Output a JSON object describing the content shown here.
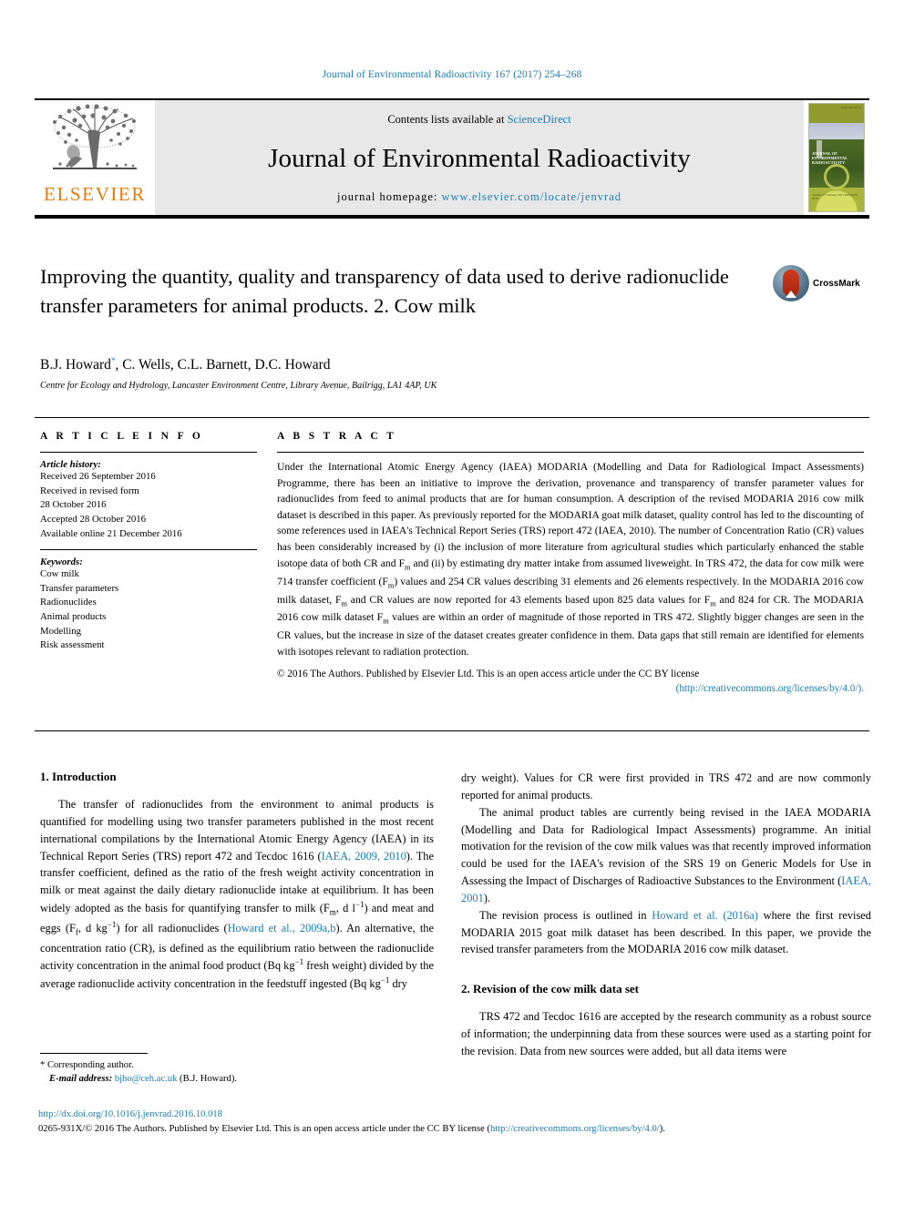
{
  "running_head": "Journal of Environmental Radioactivity 167 (2017) 254–268",
  "masthead": {
    "publisher": "ELSEVIER",
    "contents_prefix": "Contents lists available at ",
    "contents_link": "ScienceDirect",
    "journal_title": "Journal of Environmental Radioactivity",
    "homepage_prefix": "journal homepage: ",
    "homepage_url": "www.elsevier.com/locate/jenvrad",
    "cover_top_label": "ISSN 0265-931X",
    "cover_title_line1": "JOURNAL OF",
    "cover_title_line2": "ENVIRONMENTAL",
    "cover_title_line3": "RADIOACTIVITY",
    "cover_bottom_label": "Volume 167\nFebruary 2017\nISSN 0265-931X"
  },
  "article": {
    "title": "Improving the quantity, quality and transparency of data used to derive radionuclide transfer parameters for animal products. 2. Cow milk",
    "authors": "B.J. Howard",
    "authors_rest": ", C. Wells, C.L. Barnett, D.C. Howard",
    "corresponding_marker": "*",
    "affiliation": "Centre for Ecology and Hydrology, Lancaster Environment Centre, Library Avenue, Bailrigg, LA1 4AP, UK",
    "crossmark_label": "CrossMark"
  },
  "article_info": {
    "heading": "A R T I C L E    I N F O",
    "history_label": "Article history:",
    "history": [
      "Received 26 September 2016",
      "Received in revised form",
      "28 October 2016",
      "Accepted 28 October 2016",
      "Available online 21 December 2016"
    ],
    "keywords_label": "Keywords:",
    "keywords": [
      "Cow milk",
      "Transfer parameters",
      "Radionuclides",
      "Animal products",
      "Modelling",
      "Risk assessment"
    ]
  },
  "abstract": {
    "heading": "A B S T R A C T",
    "part1": "Under the International Atomic Energy Agency (IAEA) MODARIA (Modelling and Data for Radiological Impact Assessments) Programme, there has been an initiative to improve the derivation, provenance and transparency of transfer parameter values for radionuclides from feed to animal products that are for human consumption. A description of the revised MODARIA 2016 cow milk dataset is described in this paper. As previously reported for the MODARIA goat milk dataset, quality control has led to the discounting of some references used in IAEA's Technical Report Series (TRS) report 472 (IAEA, 2010). The number of Concentration Ratio (CR) values has been considerably increased by (i) the inclusion of more literature from agricultural studies which particularly enhanced the stable isotope data of both CR and F",
    "sub1": "m",
    "part2": " and (ii) by estimating dry matter intake from assumed liveweight. In TRS 472, the data for cow milk were 714 transfer coefficient (F",
    "sub2": "m",
    "part3": ") values and 254 CR values describing 31 elements and 26 elements respectively. In the MODARIA 2016 cow milk dataset, F",
    "sub3": "m",
    "part4": " and CR values are now reported for 43 elements based upon 825 data values for F",
    "sub4": "m",
    "part5": " and 824 for CR. The MODARIA 2016 cow milk dataset F",
    "sub5": "m",
    "part6": " values are within an order of magnitude of those reported in TRS 472. Slightly bigger changes are seen in the CR values, but the increase in size of the dataset creates greater confidence in them. Data gaps that still remain are identified for elements with isotopes relevant to radiation protection.",
    "copyright": "© 2016 The Authors. Published by Elsevier Ltd. This is an open access article under the CC BY license",
    "license_url": "(http://creativecommons.org/licenses/by/4.0/)."
  },
  "sections": {
    "intro_heading": "1. Introduction",
    "intro_p1_a": "The transfer of radionuclides from the environment to animal products is quantified for modelling using two transfer parameters published in the most recent international compilations by the International Atomic Energy Agency (IAEA) in its Technical Report Series (TRS) report 472 and Tecdoc 1616 (",
    "intro_p1_ref1": "IAEA, 2009, 2010",
    "intro_p1_b": "). The transfer coefficient, defined as the ratio of the fresh weight activity concentration in milk or meat against the daily dietary radionuclide intake at equilibrium. It has been widely adopted as the basis for quantifying transfer to milk (F",
    "intro_sub_m": "m",
    "intro_p1_c": ", d l",
    "intro_sup_n1": "−1",
    "intro_p1_d": ") and meat and eggs (F",
    "intro_sub_f": "f",
    "intro_p1_e": ", d kg",
    "intro_sup_n2": "−1",
    "intro_p1_f": ") for all radionuclides (",
    "intro_p1_ref2": "Howard et al., 2009a,b",
    "intro_p1_g": "). An alternative, the concentration ratio (CR), is defined as the equilibrium ratio between the radionuclide activity concentration in the animal food product (Bq kg",
    "intro_sup_n3": "−1",
    "intro_p1_h": " fresh weight) divided by the average radionuclide activity concentration in the feedstuff ingested (Bq kg",
    "intro_sup_n4": "−1",
    "intro_p1_i": " dry weight). Values for CR were first provided in TRS 472 and are now commonly reported for animal products.",
    "intro_p2_a": "The animal product tables are currently being revised in the IAEA MODARIA (Modelling and Data for Radiological Impact Assessments) programme. An initial motivation for the revision of the cow milk values was that recently improved information could be used for the IAEA's revision of the SRS 19 on Generic Models for Use in Assessing the Impact of Discharges of Radioactive Substances to the Environment (",
    "intro_p2_ref": "IAEA, 2001",
    "intro_p2_b": ").",
    "intro_p3_a": "The revision process is outlined in ",
    "intro_p3_ref": "Howard et al. (2016a)",
    "intro_p3_b": " where the first revised MODARIA 2015 goat milk dataset has been described. In this paper, we provide the revised transfer parameters from the MODARIA 2016 cow milk dataset.",
    "revision_heading": "2. Revision of the cow milk data set",
    "revision_p1": "TRS 472 and Tecdoc 1616 are accepted by the research community as a robust source of information; the underpinning data from these sources were used as a starting point for the revision. Data from new sources were added, but all data items were"
  },
  "footer": {
    "corresponding_marker": "*",
    "corresponding_label": " Corresponding author.",
    "email_label": "E-mail address: ",
    "email": "bjho@ceh.ac.uk",
    "email_suffix": " (B.J. Howard).",
    "doi": "http://dx.doi.org/10.1016/j.jenvrad.2016.10.018",
    "issn_prefix": "0265-931X/© 2016 The Authors. Published by Elsevier Ltd. This is an open access article under the CC BY license (",
    "issn_link": "http://creativecommons.org/licenses/by/4.0/",
    "issn_suffix": ")."
  },
  "colors": {
    "link": "#1a7db6",
    "elsevier_orange": "#ec7a08",
    "masthead_grey": "#e8e8e8"
  }
}
